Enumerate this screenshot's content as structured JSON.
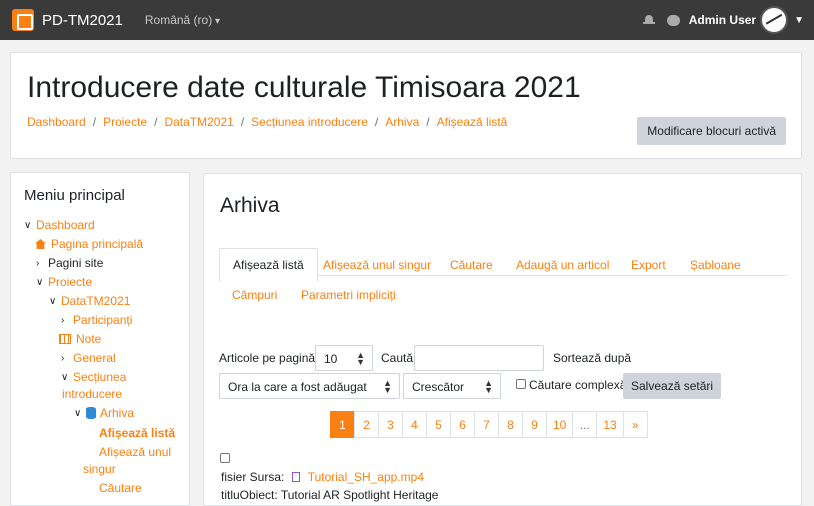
{
  "navbar": {
    "brand": "PD-TM2021",
    "language": "Română (ro)",
    "user_name": "Admin User"
  },
  "header": {
    "title": "Introducere date culturale Timisoara 2021",
    "breadcrumb": [
      "Dashboard",
      "Proiecte",
      "DataTM2021",
      "Secțiunea introducere",
      "Arhiva",
      "Afișează listă"
    ],
    "edit_button": "Modificare blocuri activă"
  },
  "sidebar": {
    "title": "Meniu principal",
    "items": [
      {
        "label": "Dashboard"
      },
      {
        "label": "Pagina principală"
      },
      {
        "label": "Pagini site"
      },
      {
        "label": "Proiecte"
      },
      {
        "label": "DataTM2021"
      },
      {
        "label": "Participanți"
      },
      {
        "label": "Note"
      },
      {
        "label": "General"
      },
      {
        "label": "Secțiunea"
      },
      {
        "label": "introducere"
      },
      {
        "label": "Arhiva"
      },
      {
        "label": "Afișează listă"
      },
      {
        "label": "Afișează unul"
      },
      {
        "label": "singur"
      },
      {
        "label": "Căutare"
      }
    ]
  },
  "main": {
    "title": "Arhiva",
    "tabs": [
      "Afișează listă",
      "Afișează unul singur",
      "Căutare",
      "Adaugă un articol",
      "Export",
      "Șabloane",
      "Câmpuri",
      "Parametri impliciți"
    ],
    "filters": {
      "per_page_label": "Articole pe pagină",
      "per_page_value": "10",
      "search_label": "Caută",
      "search_value": "",
      "sort_label": "Sortează după",
      "sort_value": "Ora la care a fost adăugat",
      "order_value": "Crescător",
      "advanced_label": "Căutare complexă",
      "save_button": "Salvează setări"
    },
    "pagination": [
      "1",
      "2",
      "3",
      "4",
      "5",
      "6",
      "7",
      "8",
      "9",
      "10",
      "...",
      "13",
      "»"
    ],
    "record": {
      "file_label": "fisier Sursa:",
      "file_name": "Tutorial_SH_app.mp4",
      "object_label": "titluObiect:",
      "object_value": "Tutorial AR Spotlight Heritage"
    }
  }
}
